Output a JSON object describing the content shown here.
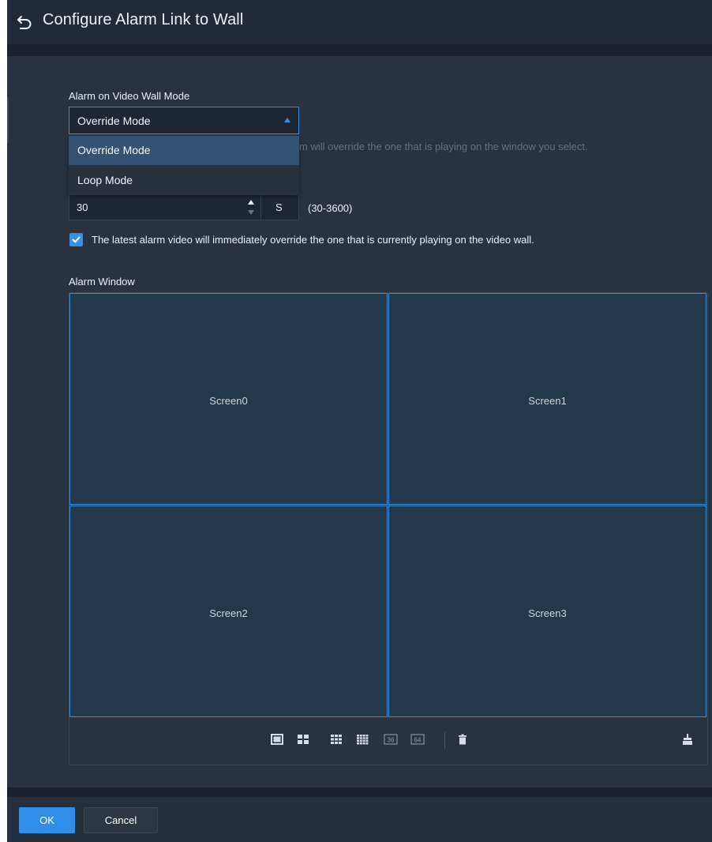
{
  "window": {
    "title": "Configure Alarm Link to Wall"
  },
  "mode": {
    "label": "Alarm on Video Wall Mode",
    "selected": "Override Mode",
    "options": [
      "Override Mode",
      "Loop Mode"
    ],
    "hidden_hint_fragment": "m will override the one that is playing on the window you select."
  },
  "interval": {
    "value": "30",
    "unit": "S",
    "range": "(30-3600)"
  },
  "override_option": {
    "checked": true,
    "label": "The latest alarm video will immediately override the one that is currently playing on the video wall."
  },
  "alarm_window": {
    "label": "Alarm Window",
    "screens": [
      "Screen0",
      "Screen1",
      "Screen2",
      "Screen3"
    ],
    "toolbar_icons": [
      "single-split-icon",
      "four-split-icon",
      "nine-split-icon",
      "sixteen-split-icon",
      "thirty-six-split-icon",
      "sixty-four-split-icon",
      "delete-icon",
      "clear-icon"
    ],
    "toolbar_labels": {
      "thirty_six": "36",
      "sixty_four": "64"
    }
  },
  "footer": {
    "ok_label": "OK",
    "cancel_label": "Cancel"
  },
  "colors": {
    "accent": "#3b8fe0",
    "screen_bg": "#24384b",
    "panel_bg": "#2a3240"
  }
}
